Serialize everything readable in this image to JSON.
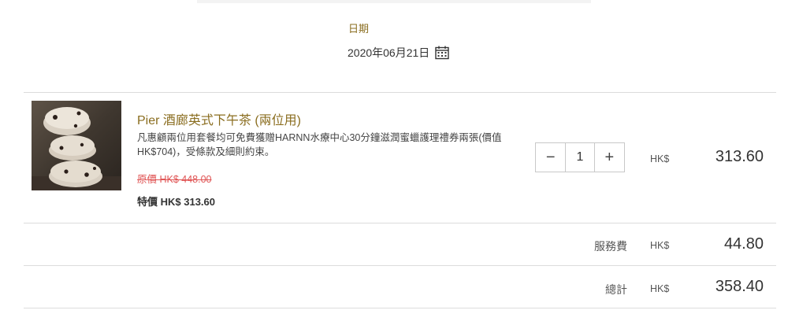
{
  "date_section": {
    "label": "日期",
    "value": "2020年06月21日",
    "icon": "calendar-icon"
  },
  "item": {
    "image_icon": "scone-stack-image",
    "title": "Pier 酒廊英式下午茶 (兩位用)",
    "description": "凡惠顧兩位用套餐均可免費獲贈HARNN水療中心30分鐘滋潤蜜蠟護理禮券兩張(價值HK$704)，受條款及細則約束。",
    "original_price": "原價 HK$ 448.00",
    "special_price": "特價 HK$ 313.60",
    "quantity": "1",
    "decrement_label": "−",
    "increment_label": "+",
    "currency": "HK$",
    "line_total": "313.60"
  },
  "service_fee": {
    "label": "服務費",
    "currency": "HK$",
    "amount": "44.80"
  },
  "total": {
    "label": "總計",
    "currency": "HK$",
    "amount": "358.40"
  },
  "colors": {
    "accent": "#8a6d1f",
    "strike_red": "#e05555",
    "divider": "#dcdcdc"
  }
}
